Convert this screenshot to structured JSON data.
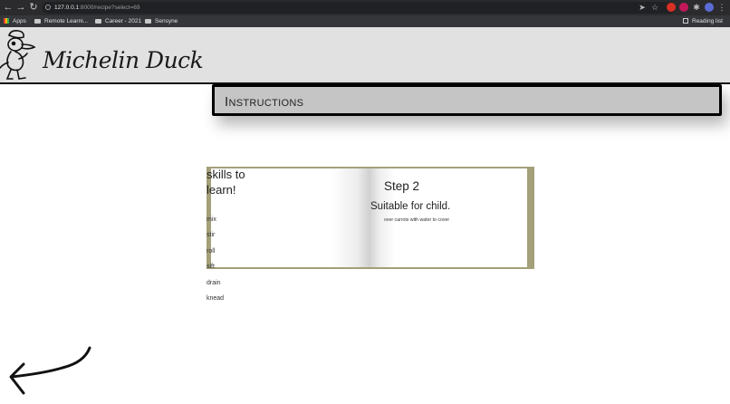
{
  "browser": {
    "url_host": "127.0.0.1",
    "url_path": ":8000/recipe?select=69",
    "nav": {
      "back": "←",
      "forward": "→",
      "reload": "↻"
    },
    "bookmarks": [
      {
        "label": "Apps",
        "icon": "apps-grid-icon"
      },
      {
        "label": "Remote Learni...",
        "icon": "folder-icon"
      },
      {
        "label": "Career - 2021",
        "icon": "folder-icon"
      },
      {
        "label": "Sensyne",
        "icon": "folder-icon"
      }
    ],
    "reading_list": "Reading list"
  },
  "site": {
    "title": "Michelin Duck"
  },
  "section": {
    "heading": "Instructions"
  },
  "skills": {
    "heading": "skills to learn!",
    "items": [
      "mix",
      "stir",
      "roll",
      "sift",
      "drain",
      "knead"
    ]
  },
  "step": {
    "title": "Step 2",
    "suitability": "Suitable for child.",
    "text": "over carrots with water to cover"
  },
  "colors": {
    "header_bg": "#e1e1e1",
    "banner_bg": "#c5c5c5",
    "book_cover": "#a3a07a"
  }
}
